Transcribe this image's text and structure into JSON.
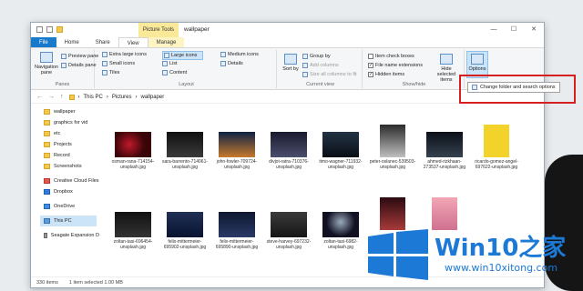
{
  "window": {
    "title": "wallpaper",
    "context_tab": "Picture Tools",
    "controls": [
      "—",
      "☐",
      "✕"
    ]
  },
  "tabs": [
    "File",
    "Home",
    "Share",
    "View",
    "Manage"
  ],
  "ribbon": {
    "panes": {
      "label": "Panes",
      "navigation_pane": "Navigation pane",
      "preview_pane": "Preview pane",
      "details_pane": "Details pane"
    },
    "layout": {
      "label": "Layout",
      "items": [
        "Extra large icons",
        "Large icons",
        "Medium icons",
        "Small icons",
        "List",
        "Details",
        "Tiles",
        "Content"
      ],
      "selected": "Large icons"
    },
    "current_view": {
      "label": "Current view",
      "sort_by": "Sort by",
      "group_by": "Group by",
      "add_columns": "Add columns",
      "size_columns": "Size all columns to fit"
    },
    "show_hide": {
      "label": "Show/hide",
      "item_check_boxes": "Item check boxes",
      "file_name_extensions": "File name extensions",
      "hidden_items": "Hidden items",
      "hide_selected": "Hide selected items",
      "checked": {
        "item_check_boxes": false,
        "file_name_extensions": true,
        "hidden_items": true
      }
    },
    "options": "Options",
    "options_menu_item": "Change folder and search options"
  },
  "address": {
    "crumbs": [
      "This PC",
      "Pictures",
      "wallpaper"
    ]
  },
  "nav": [
    "wallpaper",
    "graphics for vid",
    "etc",
    "Projects",
    "Record",
    "Screenshots",
    "Creative Cloud Files",
    "Dropbox",
    "OneDrive",
    "This PC",
    "Seagate Expansion D"
  ],
  "files_row1": [
    "osman-rana-714154-unsplash.jpg",
    "sara-barrento-714061-unsplash.jpg",
    "john-fowler-709724-unsplash.jpg",
    "divjot-ratra-710376-unsplash.jpg",
    "timo-wagner-711932-unsplash.jpg",
    "peter-oslanec-539503-unsplash.jpg",
    "ahmed-rizkhaan-273537-unsplash.jpg",
    "ricardo-gomez-angel-697622-unsplash.jpg"
  ],
  "files_row2": [
    "zoltan-tasi-696454-unsplash.jpg",
    "felix-mittermeier-695902-unsplash.jpg",
    "felix-mittermeier-695890-unsplash.jpg",
    "steve-harvey-697232-unsplash.jpg",
    "zoltan-tasi-6982-unsplash.jpg"
  ],
  "status": {
    "count": "330 items",
    "selection": "1 item selected  1.00 MB"
  },
  "watermark": {
    "title": "Win10",
    "title_zh": "之家",
    "url": "www.win10xitong.com"
  }
}
